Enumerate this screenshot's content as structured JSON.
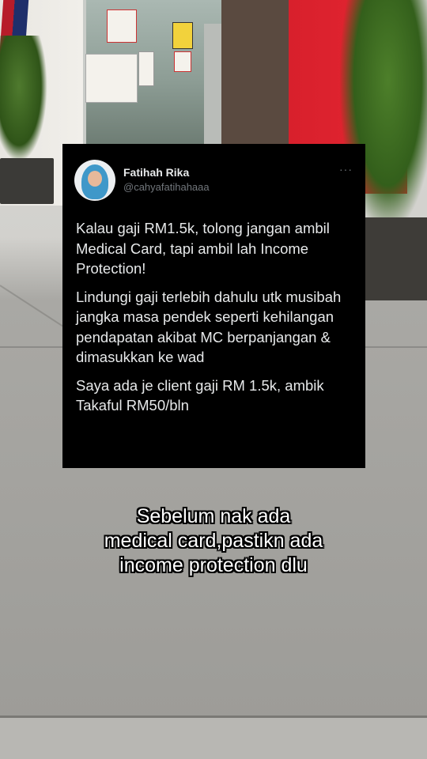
{
  "tweet": {
    "author_name": "Fatihah Rika",
    "author_handle": "@cahyafatihahaaa",
    "more_label": "···",
    "paragraphs": [
      "Kalau gaji RM1.5k, tolong jangan ambil Medical Card, tapi ambil lah Income Protection!",
      "Lindungi gaji terlebih dahulu utk musibah jangka masa pendek seperti kehilangan pendapatan akibat MC berpanjangan & dimasukkan ke wad",
      "Saya ada je client gaji RM 1.5k, ambik Takaful RM50/bln"
    ]
  },
  "caption": {
    "lines": [
      "Sebelum nak ada",
      "medical card,pastikn ada",
      "income protection dlu"
    ]
  },
  "colors": {
    "card_background": "#000000",
    "text_primary": "#e7e9ea",
    "text_secondary": "#71767b",
    "caption_text": "#ffffff",
    "caption_outline": "#000000"
  }
}
